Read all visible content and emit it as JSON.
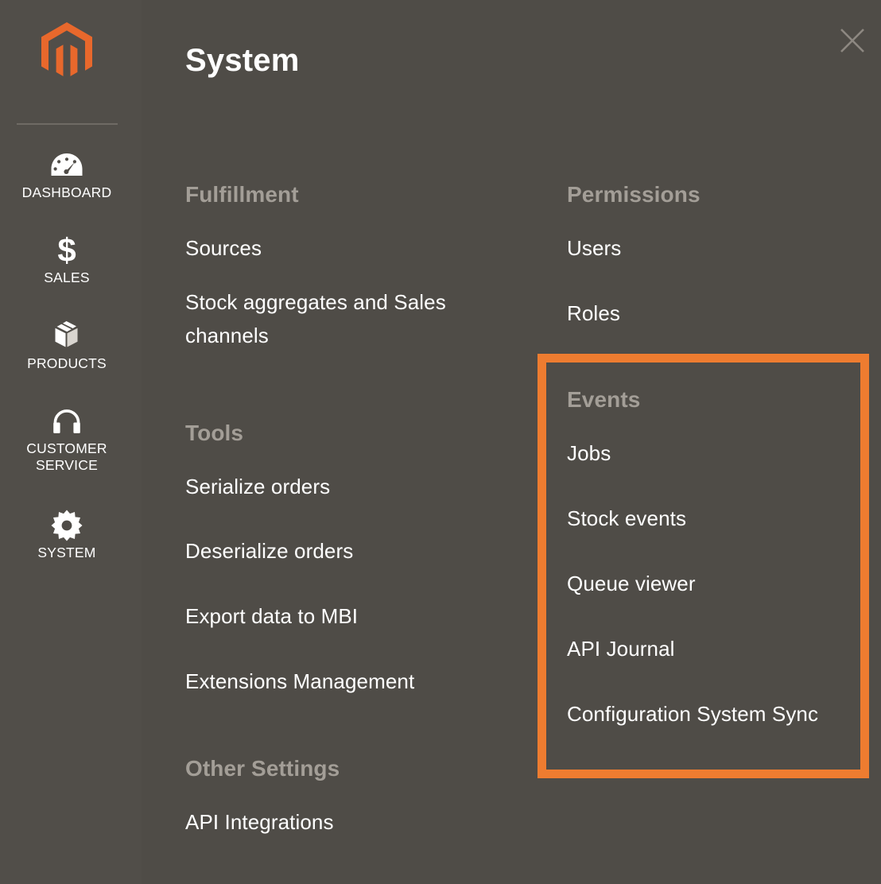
{
  "app": {
    "brand_logo": "magento-logo-icon",
    "accent_color": "#e8682c",
    "highlight_color": "#ee7c30",
    "background_color": "#4f4c47",
    "sidebar_color": "#514e49",
    "group_title_color": "#a39e97"
  },
  "header": {
    "title": "System",
    "close_label": "×"
  },
  "sidebar": {
    "items": [
      {
        "label": "DASHBOARD",
        "icon": "gauge-icon"
      },
      {
        "label": "SALES",
        "icon": "dollar-icon"
      },
      {
        "label": "PRODUCTS",
        "icon": "box-icon"
      },
      {
        "label": "CUSTOMER SERVICE",
        "icon": "headset-icon"
      },
      {
        "label": "SYSTEM",
        "icon": "gear-icon"
      }
    ]
  },
  "menu": {
    "left_groups": [
      {
        "title": "Fulfillment",
        "items": [
          {
            "label": "Sources"
          },
          {
            "label": "Stock aggregates and Sales channels"
          }
        ]
      },
      {
        "title": "Tools",
        "items": [
          {
            "label": "Serialize orders"
          },
          {
            "label": "Deserialize orders"
          },
          {
            "label": "Export data to MBI"
          },
          {
            "label": "Extensions Management"
          }
        ]
      },
      {
        "title": "Other Settings",
        "items": [
          {
            "label": "API Integrations"
          }
        ]
      }
    ],
    "right_groups": [
      {
        "title": "Permissions",
        "items": [
          {
            "label": "Users"
          },
          {
            "label": "Roles"
          }
        ]
      },
      {
        "title": "Events",
        "highlighted": true,
        "items": [
          {
            "label": "Jobs"
          },
          {
            "label": "Stock events"
          },
          {
            "label": "Queue viewer"
          },
          {
            "label": "API Journal"
          },
          {
            "label": "Configuration System Sync"
          }
        ]
      }
    ]
  }
}
